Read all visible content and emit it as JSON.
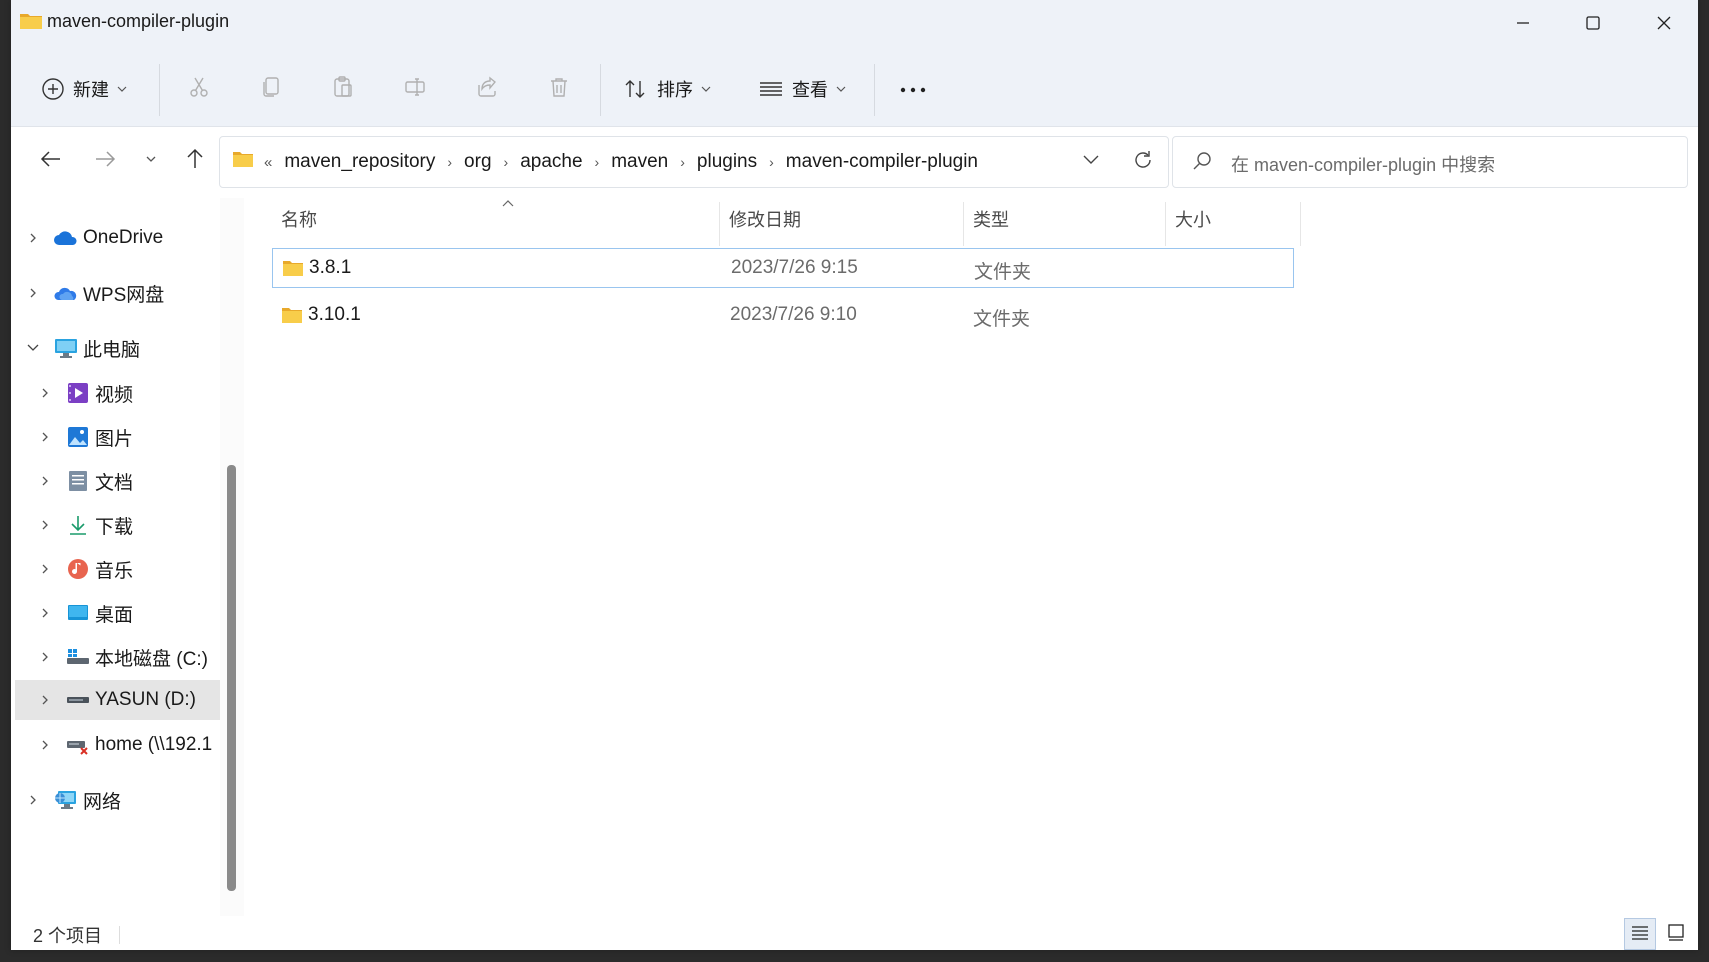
{
  "window": {
    "title": "maven-compiler-plugin",
    "minimize_icon": "minimize-icon",
    "maximize_icon": "maximize-icon",
    "close_icon": "close-icon"
  },
  "toolbar": {
    "new_label": "新建",
    "sort_label": "排序",
    "view_label": "查看",
    "more_label": "•••",
    "icons": [
      "new-icon",
      "cut-icon",
      "copy-icon",
      "paste-icon",
      "rename-icon",
      "share-icon",
      "delete-icon",
      "sort-icon",
      "view-icon",
      "more-icon"
    ]
  },
  "address": {
    "overflow": "«",
    "crumbs": [
      "maven_repository",
      "org",
      "apache",
      "maven",
      "plugins",
      "maven-compiler-plugin"
    ],
    "separator": "›"
  },
  "search": {
    "placeholder": "在 maven-compiler-plugin 中搜索"
  },
  "sidebar": {
    "items": [
      {
        "label": "OneDrive",
        "icon": "onedrive-icon",
        "expanded": false
      },
      {
        "label": "WPS网盘",
        "icon": "wps-cloud-icon",
        "expanded": false
      },
      {
        "label": "此电脑",
        "icon": "computer-icon",
        "expanded": true
      },
      {
        "label": "视频",
        "icon": "videos-icon",
        "expanded": false
      },
      {
        "label": "图片",
        "icon": "pictures-icon",
        "expanded": false
      },
      {
        "label": "文档",
        "icon": "documents-icon",
        "expanded": false
      },
      {
        "label": "下载",
        "icon": "downloads-icon",
        "expanded": false
      },
      {
        "label": "音乐",
        "icon": "music-icon",
        "expanded": false
      },
      {
        "label": "桌面",
        "icon": "desktop-icon",
        "expanded": false
      },
      {
        "label": "本地磁盘 (C:)",
        "icon": "drive-c-icon",
        "expanded": false
      },
      {
        "label": "YASUN (D:)",
        "icon": "drive-d-icon",
        "expanded": false,
        "selected": true
      },
      {
        "label": "home (\\\\192.1",
        "icon": "network-drive-icon",
        "expanded": false
      },
      {
        "label": "网络",
        "icon": "network-icon",
        "expanded": false
      }
    ]
  },
  "columns": {
    "name": "名称",
    "modified": "修改日期",
    "type": "类型",
    "size": "大小"
  },
  "files": [
    {
      "name": "3.8.1",
      "modified": "2023/7/26 9:15",
      "type": "文件夹",
      "size": "",
      "selected": true
    },
    {
      "name": "3.10.1",
      "modified": "2023/7/26 9:10",
      "type": "文件夹",
      "size": "",
      "selected": false
    }
  ],
  "status": {
    "count": "2 个项目"
  },
  "colors": {
    "chrome_bg": "#eef2f8",
    "selection_border": "#99c5ef",
    "folder_yellow": "#f5c642"
  }
}
